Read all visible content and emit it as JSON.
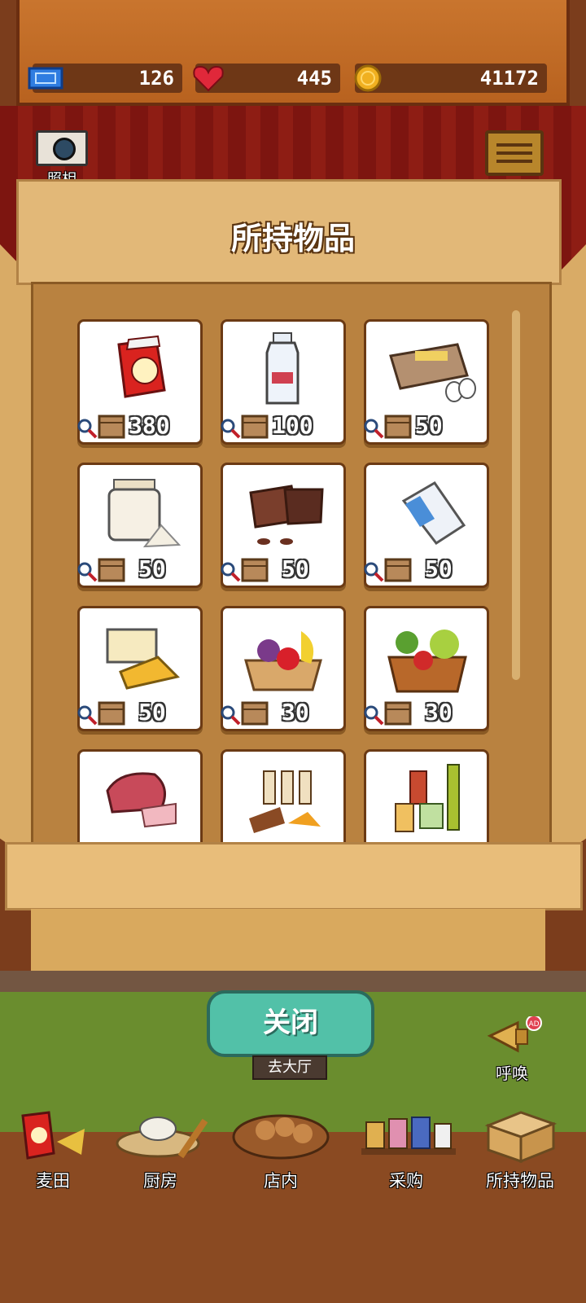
{
  "stats": {
    "tickets": "126",
    "hearts": "445",
    "coins": "41172"
  },
  "camera": {
    "label": "照相"
  },
  "panel": {
    "title": "所持物品"
  },
  "items": [
    {
      "icon": "flour-bag-icon",
      "price": "380"
    },
    {
      "icon": "milk-bottle-icon",
      "price": "100"
    },
    {
      "icon": "egg-tray-icon",
      "price": "50"
    },
    {
      "icon": "sugar-jar-icon",
      "price": "50"
    },
    {
      "icon": "chocolate-icon",
      "price": "50"
    },
    {
      "icon": "cream-carton-icon",
      "price": "50"
    },
    {
      "icon": "butter-cheese-icon",
      "price": "50"
    },
    {
      "icon": "fruit-basket-icon",
      "price": "30"
    },
    {
      "icon": "vegetable-basket-icon",
      "price": "30"
    },
    {
      "icon": "meat-icon",
      "price": ""
    },
    {
      "icon": "spice-bottles-icon",
      "price": ""
    },
    {
      "icon": "oil-bottles-icon",
      "price": ""
    }
  ],
  "close_button": "关闭",
  "go_hall": "去大厅",
  "horn": {
    "label": "呼唤",
    "badge": "AD"
  },
  "nav": [
    {
      "label": "麦田",
      "icon": "wheat-field-icon"
    },
    {
      "label": "厨房",
      "icon": "kitchen-icon"
    },
    {
      "label": "店内",
      "icon": "store-icon"
    },
    {
      "label": "采购",
      "icon": "purchase-icon"
    },
    {
      "label": "所持物品",
      "icon": "inventory-box-icon"
    }
  ]
}
